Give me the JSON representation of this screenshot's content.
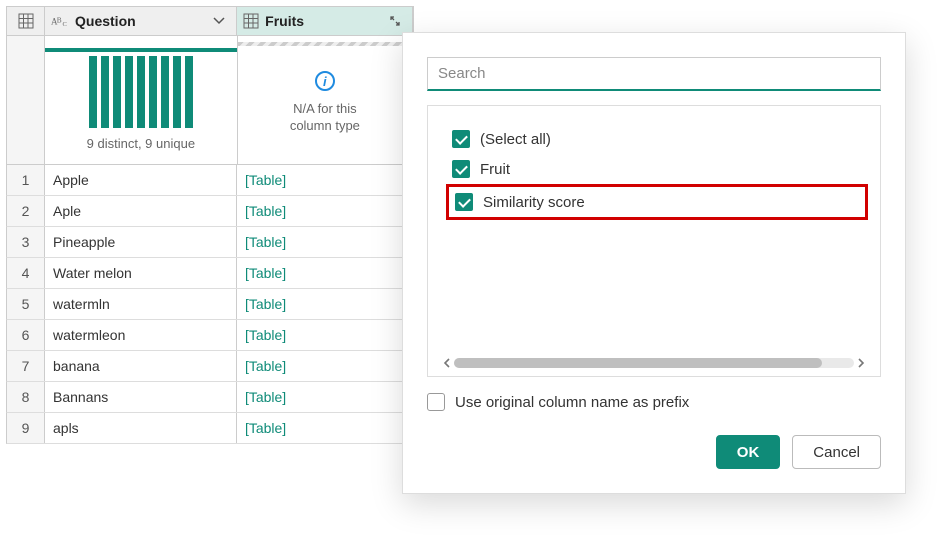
{
  "columns": {
    "question": {
      "label": "Question",
      "dist_text": "9 distinct, 9 unique"
    },
    "fruits": {
      "label": "Fruits",
      "na_line1": "N/A for this",
      "na_line2": "column type"
    }
  },
  "rows": [
    {
      "n": "1",
      "question": "Apple",
      "fruits": "[Table]"
    },
    {
      "n": "2",
      "question": "Aple",
      "fruits": "[Table]"
    },
    {
      "n": "3",
      "question": "Pineapple",
      "fruits": "[Table]"
    },
    {
      "n": "4",
      "question": "Water melon",
      "fruits": "[Table]"
    },
    {
      "n": "5",
      "question": "watermln",
      "fruits": "[Table]"
    },
    {
      "n": "6",
      "question": "watermleon",
      "fruits": "[Table]"
    },
    {
      "n": "7",
      "question": "banana",
      "fruits": "[Table]"
    },
    {
      "n": "8",
      "question": "Bannans",
      "fruits": "[Table]"
    },
    {
      "n": "9",
      "question": "apls",
      "fruits": "[Table]"
    }
  ],
  "dialog": {
    "search_placeholder": "Search",
    "options": {
      "select_all": "(Select all)",
      "fruit": "Fruit",
      "similarity_score": "Similarity score"
    },
    "prefix_label": "Use original column name as prefix",
    "ok": "OK",
    "cancel": "Cancel"
  }
}
